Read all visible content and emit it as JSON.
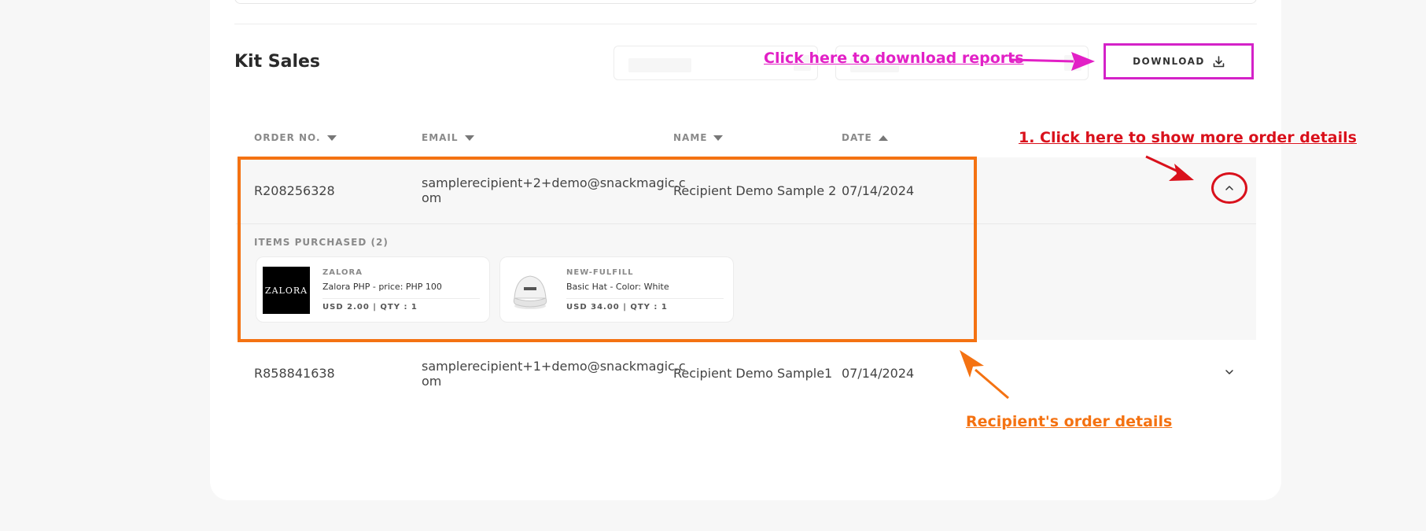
{
  "page": {
    "title": "Kit Sales"
  },
  "toolbar": {
    "download_label": "DOWNLOAD"
  },
  "table": {
    "columns": [
      {
        "label": "ORDER NO.",
        "sort": "down"
      },
      {
        "label": "EMAIL",
        "sort": "down"
      },
      {
        "label": "NAME",
        "sort": "down"
      },
      {
        "label": "DATE",
        "sort": "up"
      }
    ],
    "rows": [
      {
        "order_no": "R208256328",
        "email_line1": "samplerecipient+2+demo@snackmagic.c",
        "email_line2": "om",
        "name": "Recipient Demo Sample 2",
        "date": "07/14/2024",
        "expanded": true,
        "items_title": "ITEMS PURCHASED (2)",
        "items": [
          {
            "brand": "ZALORA",
            "logo_text": "ZALORA",
            "name": "Zalora PHP - price: PHP 100",
            "meta": "USD 2.00 | QTY : 1"
          },
          {
            "brand": "NEW-FULFILL",
            "name": "Basic Hat - Color: White",
            "meta": "USD 34.00 | QTY : 1"
          }
        ]
      },
      {
        "order_no": "R858841638",
        "email_line1": "samplerecipient+1+demo@snackmagic.c",
        "email_line2": "om",
        "name": "Recipient Demo Sample1",
        "date": "07/14/2024",
        "expanded": false
      }
    ]
  },
  "annotations": {
    "download": "Click here to download reports",
    "expand": "1. Click here to show more order details",
    "details": "Recipient's order details",
    "colors": {
      "magenta": "#e220c6",
      "red": "#d9111c",
      "orange": "#f47212"
    }
  },
  "icons": [
    "download-icon",
    "sort-down-icon",
    "sort-up-icon",
    "chevron-up-icon",
    "chevron-down-icon"
  ]
}
